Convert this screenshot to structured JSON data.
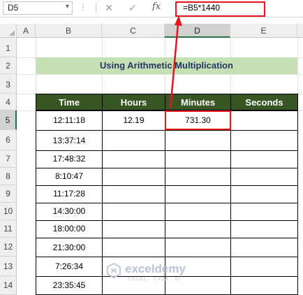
{
  "formula_bar": {
    "name_box": "D5",
    "name_box_caret": "▾",
    "dots": "⋮",
    "cancel_icon": "✕",
    "enter_icon": "✓",
    "fx_label": "fx",
    "formula": "=B5*1440"
  },
  "columns": [
    "A",
    "B",
    "C",
    "D",
    "E"
  ],
  "selected_column": "D",
  "rows": [
    "1",
    "2",
    "3",
    "4",
    "5",
    "6",
    "7",
    "8",
    "9",
    "10",
    "11",
    "12",
    "13",
    "14"
  ],
  "selected_row": "5",
  "title": "Using Arithmetic Multiplication",
  "table": {
    "headers": [
      "Time",
      "Hours",
      "Minutes",
      "Seconds"
    ],
    "rows": [
      [
        "12:11:18",
        "12.19",
        "731.30",
        ""
      ],
      [
        "13:37:14",
        "",
        "",
        ""
      ],
      [
        "17:48:32",
        "",
        "",
        ""
      ],
      [
        "8:10:47",
        "",
        "",
        ""
      ],
      [
        "11:17:28",
        "",
        "",
        ""
      ],
      [
        "14:30:00",
        "",
        "",
        ""
      ],
      [
        "18:00:00",
        "",
        "",
        ""
      ],
      [
        "21:30:00",
        "",
        "",
        ""
      ],
      [
        "7:26:34",
        "",
        "",
        ""
      ],
      [
        "23:35:45",
        "",
        "",
        ""
      ]
    ]
  },
  "watermark": {
    "name": "exceldemy",
    "tagline": "EXCEL · DATA · BI"
  },
  "colors": {
    "title_fill": "#c6e0b4",
    "header_fill": "#375623",
    "highlight": "#e8141c",
    "selection": "#217346"
  }
}
